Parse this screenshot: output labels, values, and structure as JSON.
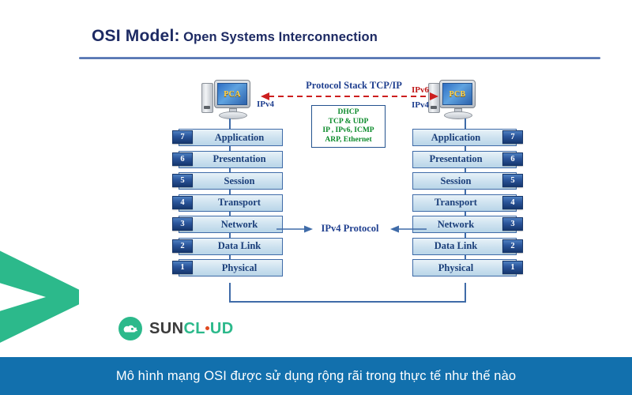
{
  "panel": {
    "title_main": "OSI Model:",
    "title_sub": "Open Systems Interconnection"
  },
  "computers": {
    "left": {
      "label": "PCA",
      "ip_v4": "IPv4"
    },
    "right": {
      "label": "PCB",
      "ip_v6": "IPv6",
      "ip_v4": "IPv4"
    }
  },
  "protocol_stack": {
    "label": "Protocol Stack TCP/IP",
    "entries": [
      "DHCP",
      "TCP & UDP",
      "IP , IPv6, ICMP",
      "ARP, Ethernet"
    ]
  },
  "middle": {
    "ipv4_protocol_label": "IPv4 Protocol"
  },
  "osi_layers": [
    {
      "number": "7",
      "name": "Application"
    },
    {
      "number": "6",
      "name": "Presentation"
    },
    {
      "number": "5",
      "name": "Session"
    },
    {
      "number": "4",
      "name": "Transport"
    },
    {
      "number": "3",
      "name": "Network"
    },
    {
      "number": "2",
      "name": "Data Link"
    },
    {
      "number": "1",
      "name": "Physical"
    }
  ],
  "logo": {
    "text_first": "SUN",
    "text_second_a": "CL",
    "text_second_b": "UD",
    "icon": "cloud-mark-icon"
  },
  "caption": {
    "text": "Mô hình mạng OSI được sử dụng rộng rãi trong thực tế như thế nào"
  },
  "colors": {
    "teal": "#2cb98b",
    "caption_blue": "#1270ad",
    "title_navy": "#1d2a63",
    "layer_blue": "#1b3f7a",
    "arrow_red": "#cc1f1f",
    "stack_green": "#0a8a2a"
  }
}
